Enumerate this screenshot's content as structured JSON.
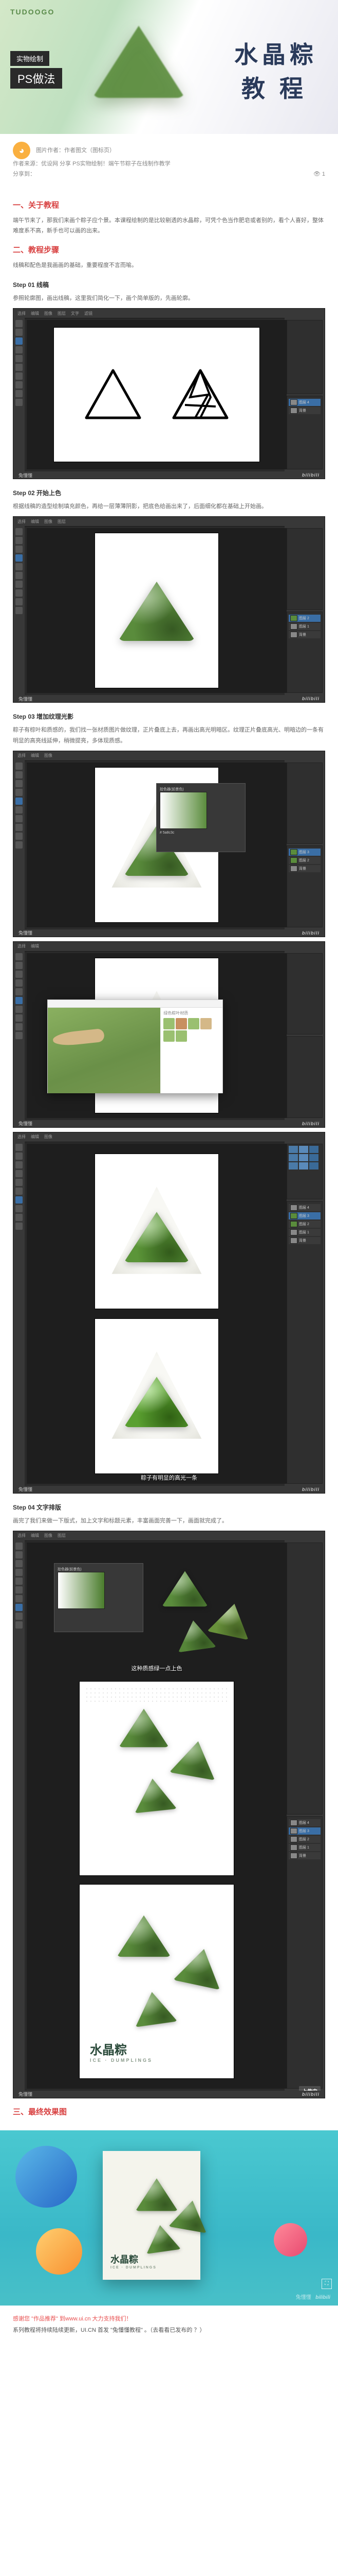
{
  "hero": {
    "logo": "TUDOOGO",
    "tag1": "实物绘制",
    "tag2": "PS做法",
    "title1": "水晶粽",
    "title2": "教程"
  },
  "meta": {
    "author_label": "图片作者：作者图文（图标页）",
    "publish": "作者来源：优设网 分享 PS实物绘制！端午节粽子在线制作教学",
    "share": "分享到：",
    "views_label": "👁 1",
    "heading1": "一、关于教程",
    "intro": "端午节来了，那我们来画个粽子应个景。本课程绘制的是比较剔透的水晶粽，可凭个色当作肥皂或者别的，看个人喜好，整体难度系不高，新手也可以画的出来。",
    "heading2": "二、教程步骤",
    "step_intro": "线稿和配色是我画画的基础，重要程度不言而喻。",
    "step01": "Step 01 线稿",
    "step01_desc": "参照轮廓图，画出线稿，这里我们简化一下，画个简单版的，先画轮廓。",
    "bili": "bilibili",
    "bili_user": "兔懂懂",
    "step02": "Step 02 开始上色",
    "step02_desc": "根据线稿的造型绘制填充颜色，再给一层薄薄阴影，把底色给画出来了，后面细化都在基础上开始画。",
    "step03": "Step 03 增加纹理光影",
    "step03_desc": "粽子有棕叶和质感的，我们找一张材质图片做纹理，正片叠底上去，再画出高光明暗区。纹理正片叠底高光、明暗边的一条有明显的高亮线延伸，稍微提亮，多体现质感。",
    "browser_title": "绿色粽叶材质",
    "step03_sub": "粽子有明显的高光一条",
    "step04": "Step 04 文字排版",
    "step04_desc": "画完了我们来做一下版式，加上文字和标题元素，丰富画面完善一下，画面就完成了。",
    "step04_sub": "这种质感绿一点上色",
    "poster_title": "水晶粽",
    "poster_sub": "ICE · DUMPLINGS",
    "uploading": "上传中",
    "heading3": "三、最终效果图",
    "footer1": "感谢您 \"作品推荐\" 到www.ui.cn 大力支持我们！",
    "footer2": "系列教程将持续陆续更新，UI.CN 首发 \"兔懂懂教程\" 。（去看看已发布的 ？）",
    "heads": [
      "选择",
      "编辑",
      "图像",
      "图层",
      "文字",
      "滤镜"
    ],
    "layers": [
      "图层 4",
      "图层 3",
      "图层 2",
      "图层 1",
      "背景"
    ],
    "cp_title": "拾色器(前景色)",
    "cp_hex": "# 5a8c3c"
  }
}
